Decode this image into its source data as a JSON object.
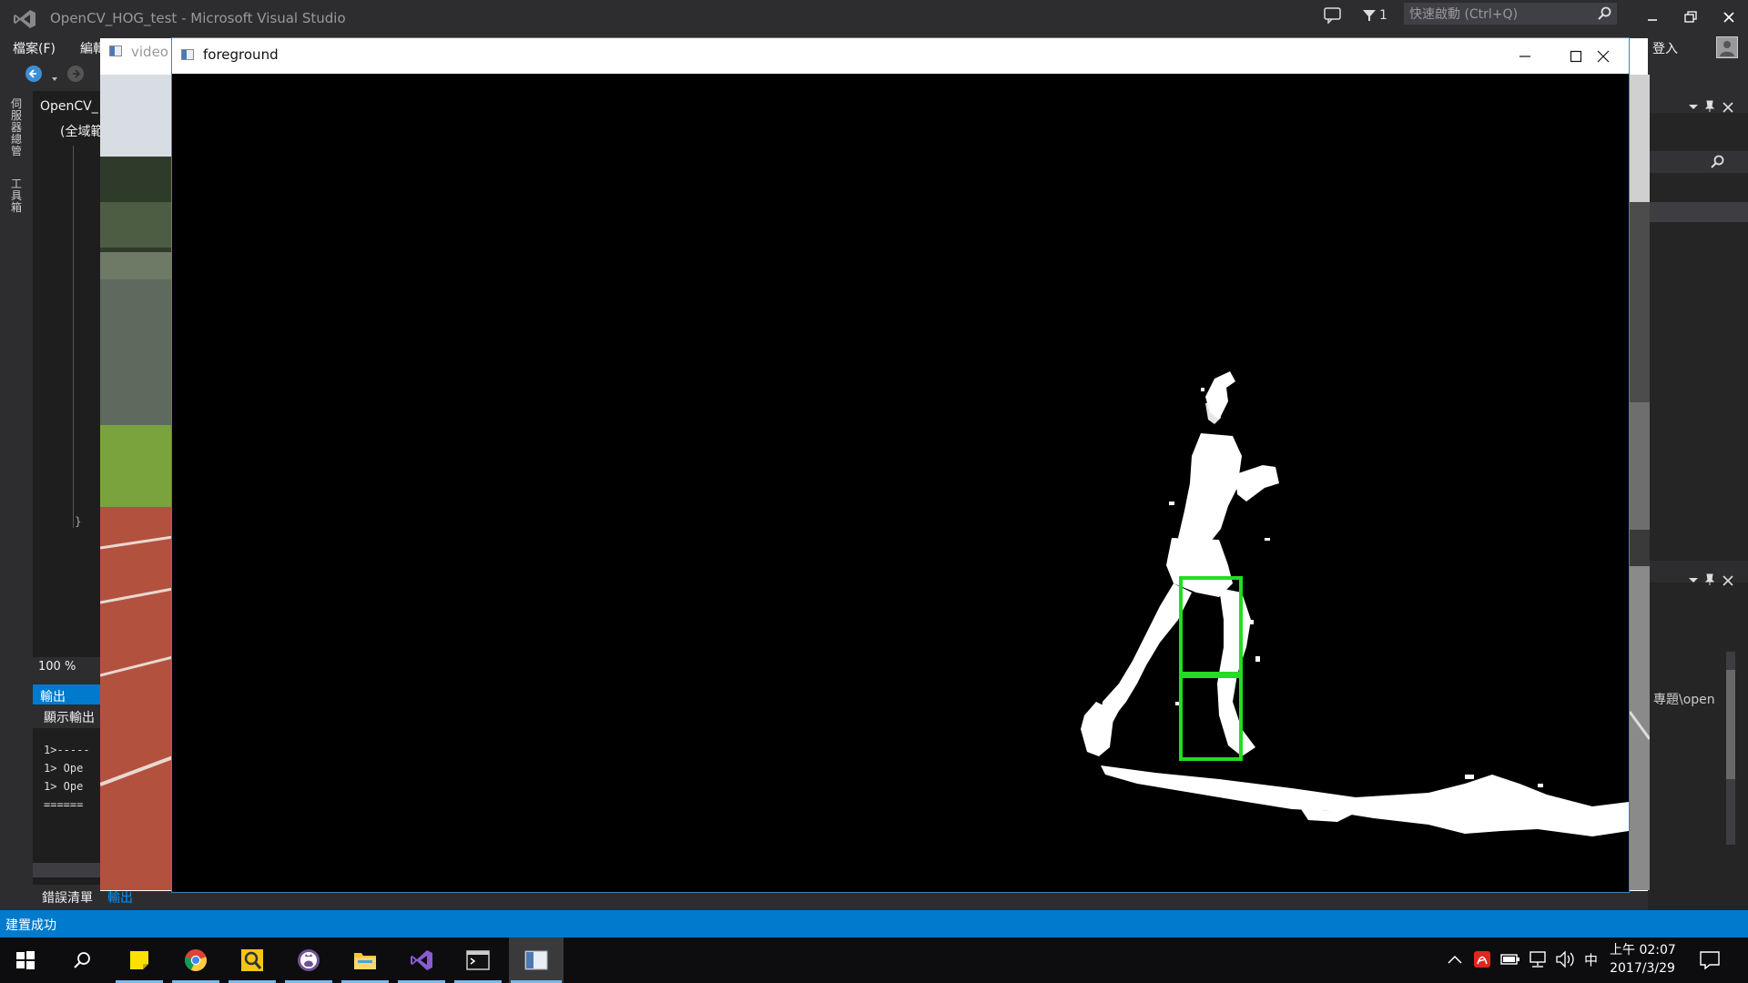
{
  "vs": {
    "window_title": "OpenCV_HOG_test - Microsoft Visual Studio",
    "notifications_count": "1",
    "quick_launch_placeholder": "快速啟動 (Ctrl+Q)",
    "sign_in": "登入",
    "menu": [
      "檔案(F)",
      "編輯"
    ],
    "left_strip": [
      "伺服器總管",
      "工具箱"
    ],
    "editor": {
      "project_tab": "OpenCV_",
      "scope": "(全域範",
      "brace": "}",
      "zoom": "100 %"
    },
    "output": {
      "tab": "輸出",
      "show_output_from": "顯示輸出",
      "lines": [
        "1>-----",
        "1>  Ope",
        "1>  Ope",
        "======"
      ]
    },
    "bottom_tabs": [
      "錯誤清單",
      "輸出"
    ],
    "right_panel": {
      "path_fragment": "專題\\open"
    },
    "status_text": "建置成功"
  },
  "video_window": {
    "title": "video"
  },
  "foreground_window": {
    "title": "foreground",
    "detections": 2
  },
  "taskbar": {
    "ime": "中",
    "time": "上午 02:07",
    "date": "2017/3/29"
  },
  "colors": {
    "vs_bg": "#2d2d30",
    "status_bar": "#007acc",
    "detection_box": "#22dd22",
    "taskbar": "#0d0d0f"
  }
}
